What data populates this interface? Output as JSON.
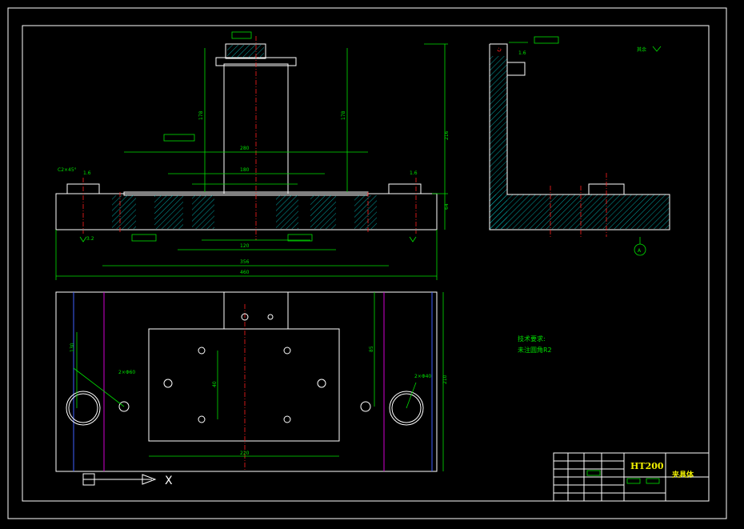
{
  "notes": {
    "heading": "技术要求:",
    "line1": "未注圆角R2"
  },
  "title_block": {
    "material": "HT200",
    "part_name": "夹具体"
  },
  "surface_note": "其余",
  "datum_letter": "A",
  "axis_label": "X",
  "dims": {
    "front_height": "216",
    "front_width_outer": "460",
    "front_width_inner": "356",
    "width_280": "280",
    "width_180": "180",
    "width_120": "120",
    "dim_178a": "178",
    "dim_178b": "178",
    "dim_64": "64",
    "plan_height": "210",
    "plan_width": "220",
    "plan_130": "130",
    "plan_40": "40",
    "plan_85": "85",
    "holes_left": "2×Φ60",
    "holes_right": "2×Φ40",
    "chamfer": "C2×45°",
    "rough_1": "1.6",
    "rough_2": "1.6",
    "rough_3": "3.2",
    "rough_4": "1.6"
  },
  "colors": {
    "frame": "#ffffff",
    "dimension": "#00e000",
    "center": "#ff2020",
    "accent": "#d000d0",
    "title": "#f0f000"
  }
}
